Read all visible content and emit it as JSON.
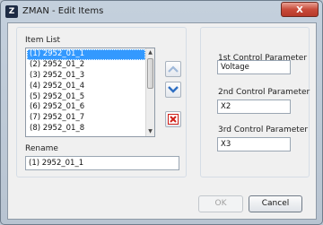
{
  "window": {
    "title": "ZMAN - Edit Items",
    "app_icon_text": "Z",
    "close_glyph": "X"
  },
  "item_list": {
    "label": "Item List",
    "items": [
      "(1) 2952_01_1",
      "(2) 2952_01_2",
      "(3) 2952_01_3",
      "(4) 2952_01_4",
      "(5) 2952_01_5",
      "(6) 2952_01_6",
      "(7) 2952_01_7",
      "(8) 2952_01_8"
    ],
    "selected_index": 0
  },
  "side_buttons": {
    "move_up_icon": "arrow-up-icon",
    "move_down_icon": "arrow-down-icon",
    "delete_icon": "delete-icon"
  },
  "rename": {
    "label": "Rename",
    "value": "(1) 2952_01_1"
  },
  "parameters": {
    "first_label": "1st Control Parameter",
    "first_value": "Voltage",
    "second_label": "2nd Control Parameter",
    "second_value": "X2",
    "third_label": "3rd Control Parameter",
    "third_value": "X3"
  },
  "footer": {
    "ok_label": "OK",
    "cancel_label": "Cancel"
  },
  "colors": {
    "selection": "#3399ff",
    "close_button": "#c84b3a",
    "arrow_blue": "#2f6fc3",
    "delete_red": "#d0201a"
  }
}
